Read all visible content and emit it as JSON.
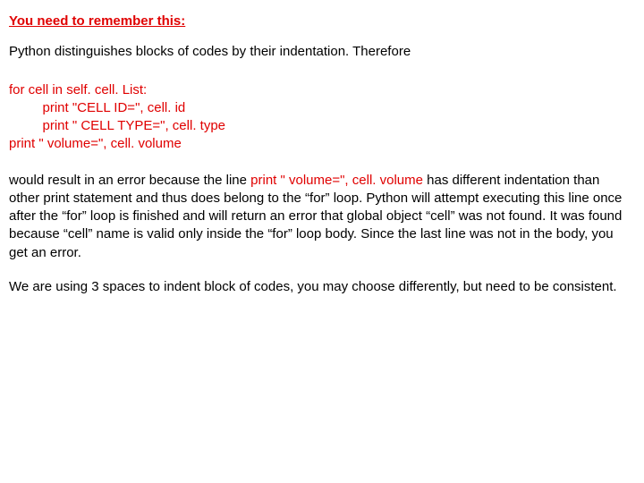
{
  "heading": "You need to remember this:",
  "intro": "Python distinguishes blocks of codes by their indentation. Therefore",
  "code": "for cell in self. cell. List:\n         print \"CELL ID=\", cell. id\n         print \" CELL TYPE=\", cell. type\nprint \" volume=\", cell. volume",
  "explain_pre": "would result in an error because the line ",
  "explain_inline": "print \" volume=\", cell. volume",
  "explain_post": " has different indentation than other print statement and thus does belong to the “for” loop. Python will attempt executing this line once after the “for” loop is finished and will return an error that global object “cell” was not found. It was found because “cell” name is valid only inside the “for” loop body. Since the last line was not in the body, you get an error.",
  "closing": "We are using 3 spaces to indent block of codes, you may choose differently, but need to be consistent."
}
